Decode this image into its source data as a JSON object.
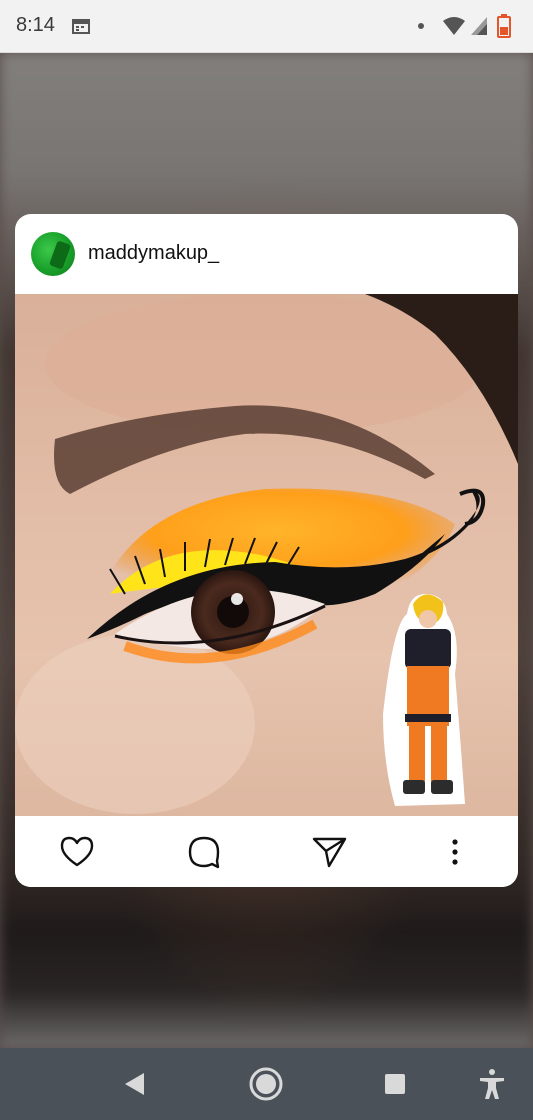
{
  "status_bar": {
    "time": "8:14",
    "icons": [
      "calendar-icon",
      "notification-dot-icon",
      "wifi-icon",
      "signal-icon",
      "battery-icon"
    ],
    "battery_color": "#e4552b"
  },
  "post": {
    "username": "maddymakup_",
    "avatar_color": "#19a02a",
    "image_description_icon": "makeup-photo",
    "actions": [
      "like-icon",
      "comment-icon",
      "share-icon",
      "more-options-icon"
    ]
  },
  "nav_bar": {
    "buttons": [
      "back-icon",
      "home-icon",
      "recents-icon",
      "accessibility-icon"
    ],
    "background": "#4a5159"
  }
}
